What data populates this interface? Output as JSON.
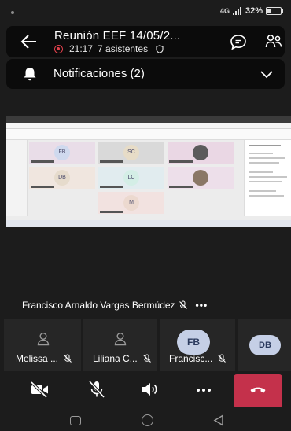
{
  "status_bar": {
    "signal_text": "4G",
    "battery_text": "32%",
    "battery_level": 0.32
  },
  "meeting": {
    "title": "Reunión EEF 14/05/2...",
    "elapsed": "21:17",
    "attendees": "7 asistentes",
    "icons": {
      "back": "arrow-left-icon",
      "recording": "recording-icon",
      "security": "shield-icon",
      "chat": "chat-icon",
      "participants": "people-icon"
    }
  },
  "notifications": {
    "label": "Notificaciones (2)",
    "icons": {
      "bell": "bell-icon",
      "expand": "chevron-down-icon"
    }
  },
  "shared_screen": {
    "tiles": [
      {
        "initials": "FB"
      },
      {
        "initials": "SC"
      },
      {
        "initials": ""
      },
      {
        "initials": "DB"
      },
      {
        "initials": "LC"
      },
      {
        "initials": ""
      },
      {
        "initials": "M"
      }
    ]
  },
  "presenter": {
    "name": "Francisco Arnaldo Vargas Bermúdez",
    "more": "•••"
  },
  "participants": [
    {
      "name": "Melissa ...",
      "avatar": "person-icon",
      "muted": true
    },
    {
      "name": "Liliana C...",
      "avatar": "person-icon",
      "muted": true
    },
    {
      "name": "Francisc...",
      "initials": "FB",
      "muted": true
    },
    {
      "initials": "DB"
    }
  ],
  "controls": {
    "camera": "camera-off-icon",
    "mic": "mic-off-icon",
    "speaker": "speaker-icon",
    "more": "more-icon",
    "hangup": "hang-up-icon"
  },
  "colors": {
    "background": "#1c1c1c",
    "header": "#0b0b0b",
    "tile": "#262626",
    "avatar": "#c5cfe6",
    "end_call": "#c4314b",
    "recording": "#e2414c"
  }
}
